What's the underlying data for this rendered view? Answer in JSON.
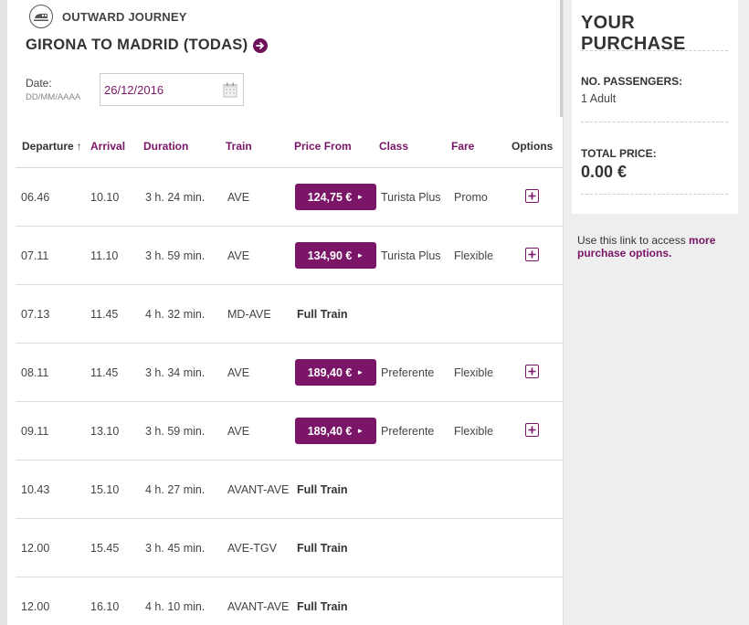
{
  "journey": {
    "label": "OUTWARD JOURNEY",
    "route": "GIRONA TO MADRID (TODAS)",
    "date_label": "Date:",
    "date_format": "DD/MM/AAAA",
    "date_value": "26/12/2016"
  },
  "table": {
    "headers": [
      "Departure",
      "Arrival",
      "Duration",
      "Train",
      "Price From",
      "Class",
      "Fare",
      "Options"
    ],
    "sort_indicator": "↑",
    "rows": [
      {
        "departure": "06.46",
        "arrival": "10.10",
        "duration": "3 h. 24 min.",
        "train": "AVE",
        "price": "124,75 €",
        "class": "Turista Plus",
        "fare": "Promo"
      },
      {
        "departure": "07.11",
        "arrival": "11.10",
        "duration": "3 h. 59 min.",
        "train": "AVE",
        "price": "134,90 €",
        "class": "Turista Plus",
        "fare": "Flexible"
      },
      {
        "departure": "07.13",
        "arrival": "11.45",
        "duration": "4 h. 32 min.",
        "train": "MD-AVE",
        "status": "Full Train"
      },
      {
        "departure": "08.11",
        "arrival": "11.45",
        "duration": "3 h. 34 min.",
        "train": "AVE",
        "price": "189,40 €",
        "class": "Preferente",
        "fare": "Flexible"
      },
      {
        "departure": "09.11",
        "arrival": "13.10",
        "duration": "3 h. 59 min.",
        "train": "AVE",
        "price": "189,40 €",
        "class": "Preferente",
        "fare": "Flexible"
      },
      {
        "departure": "10.43",
        "arrival": "15.10",
        "duration": "4 h. 27 min.",
        "train": "AVANT-AVE",
        "status": "Full Train"
      },
      {
        "departure": "12.00",
        "arrival": "15.45",
        "duration": "3 h. 45 min.",
        "train": "AVE-TGV",
        "status": "Full Train"
      },
      {
        "departure": "12.00",
        "arrival": "16.10",
        "duration": "4 h. 10 min.",
        "train": "AVANT-AVE",
        "status": "Full Train"
      }
    ]
  },
  "sidebar": {
    "title": "YOUR PURCHASE",
    "passengers_label": "NO. PASSENGERS:",
    "passengers_value": "1 Adult",
    "total_label": "TOTAL PRICE:",
    "total_value": "0.00 €",
    "note_prefix": "Use this link to access ",
    "note_link": "more purchase options."
  },
  "icons": {
    "header": "train-icon",
    "route": "arrow-right-circle-icon",
    "date": "calendar-icon",
    "options": "plus-square-icon"
  },
  "colors": {
    "accent": "#7a1567",
    "background": "#efeeef"
  }
}
